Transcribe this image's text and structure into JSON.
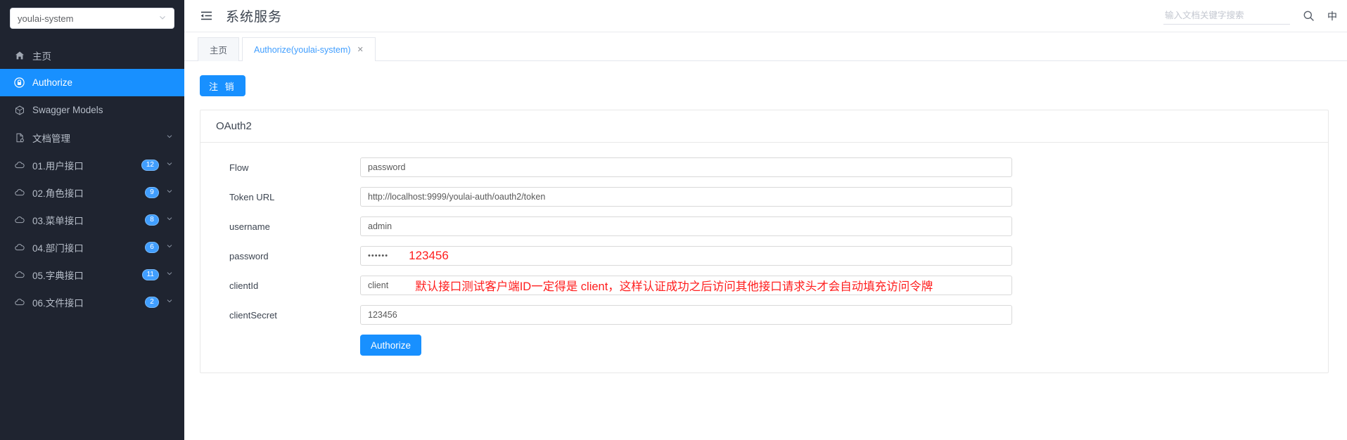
{
  "sidebar": {
    "service_select": {
      "value": "youlai-system",
      "icon": "chevron-down-icon"
    },
    "items": [
      {
        "label": "主页",
        "icon": "home-icon",
        "active": false,
        "badge": null,
        "arrow": false
      },
      {
        "label": "Authorize",
        "icon": "lock-icon",
        "active": true,
        "badge": null,
        "arrow": false
      },
      {
        "label": "Swagger Models",
        "icon": "cube-icon",
        "active": false,
        "badge": null,
        "arrow": false
      },
      {
        "label": "文档管理",
        "icon": "document-icon",
        "active": false,
        "badge": null,
        "arrow": true
      },
      {
        "label": "01.用户接口",
        "icon": "cloud-icon",
        "active": false,
        "badge": "12",
        "arrow": true
      },
      {
        "label": "02.角色接口",
        "icon": "cloud-icon",
        "active": false,
        "badge": "9",
        "arrow": true
      },
      {
        "label": "03.菜单接口",
        "icon": "cloud-icon",
        "active": false,
        "badge": "8",
        "arrow": true
      },
      {
        "label": "04.部门接口",
        "icon": "cloud-icon",
        "active": false,
        "badge": "6",
        "arrow": true
      },
      {
        "label": "05.字典接口",
        "icon": "cloud-icon",
        "active": false,
        "badge": "11",
        "arrow": true
      },
      {
        "label": "06.文件接口",
        "icon": "cloud-icon",
        "active": false,
        "badge": "2",
        "arrow": true
      }
    ]
  },
  "topbar": {
    "collapse_icon": "menu-fold-icon",
    "title": "系统服务",
    "search_placeholder": "输入文档关键字搜索",
    "search_value": "",
    "search_icon": "search-icon",
    "lang_label": "中"
  },
  "tabs": [
    {
      "label": "主页",
      "active": false,
      "closable": false
    },
    {
      "label": "Authorize(youlai-system)",
      "active": true,
      "closable": true,
      "close_label": "✕"
    }
  ],
  "content": {
    "logout_button": "注 销",
    "card_title": "OAuth2",
    "fields": [
      {
        "label": "Flow",
        "value": "password",
        "type": "text",
        "annotation": ""
      },
      {
        "label": "Token URL",
        "value": "http://localhost:9999/youlai-auth/oauth2/token",
        "type": "text",
        "annotation": ""
      },
      {
        "label": "username",
        "value": "admin",
        "type": "text",
        "annotation": ""
      },
      {
        "label": "password",
        "value": "••••••",
        "type": "password",
        "annotation": "123456"
      },
      {
        "label": "clientId",
        "value": "client",
        "type": "text",
        "annotation": "默认接口测试客户端ID一定得是 client，这样认证成功之后访问其他接口请求头才会自动填充访问令牌"
      },
      {
        "label": "clientSecret",
        "value": "123456",
        "type": "text",
        "annotation": ""
      }
    ],
    "authorize_button": "Authorize"
  },
  "colors": {
    "accent": "#1890ff",
    "sidebar_bg": "#1f2430",
    "badge": "#409eff",
    "annotation": "#ff1d1d"
  }
}
